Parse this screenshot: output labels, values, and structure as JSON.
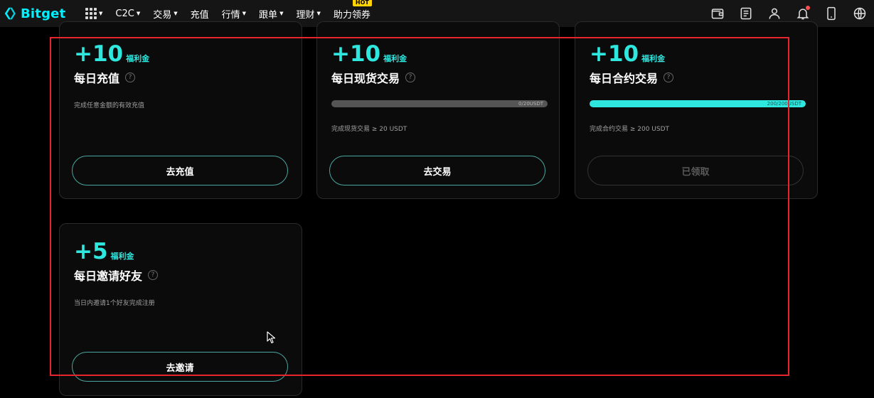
{
  "brand": {
    "name": "Bitget",
    "accent": "#00f0ff"
  },
  "nav": {
    "items": [
      {
        "label": "C2C",
        "caret": true
      },
      {
        "label": "交易",
        "caret": true
      },
      {
        "label": "充值",
        "caret": false
      },
      {
        "label": "行情",
        "caret": true
      },
      {
        "label": "跟单",
        "caret": true
      },
      {
        "label": "理财",
        "caret": true
      },
      {
        "label": "助力领券",
        "caret": false,
        "badge": "HOT"
      }
    ],
    "right_icons": [
      "wallet-icon",
      "orders-icon",
      "user-icon",
      "bell-icon",
      "download-icon",
      "globe-icon"
    ]
  },
  "tasks": [
    {
      "amount": "+10",
      "unit": "福利金",
      "title": "每日充值",
      "description": "完成任意金额的有效充值",
      "button": "去充值",
      "button_enabled": true
    },
    {
      "amount": "+10",
      "unit": "福利金",
      "title": "每日现货交易",
      "progress_label": "0/20USDT",
      "progress": 0,
      "description": "完成现货交易 ≥ 20 USDT",
      "button": "去交易",
      "button_enabled": true
    },
    {
      "amount": "+10",
      "unit": "福利金",
      "title": "每日合约交易",
      "progress_label": "200/200USDT",
      "progress": 1,
      "description": "完成合约交易 ≥ 200 USDT",
      "button": "已领取",
      "button_enabled": false
    },
    {
      "amount": "+5",
      "unit": "福利金",
      "title": "每日邀请好友",
      "description": "当日内邀请1个好友完成注册",
      "button": "去邀请",
      "button_enabled": true
    }
  ],
  "colors": {
    "highlight": "#e8242c",
    "reward": "#2ee8e0",
    "button_border": "#4aa59e"
  }
}
